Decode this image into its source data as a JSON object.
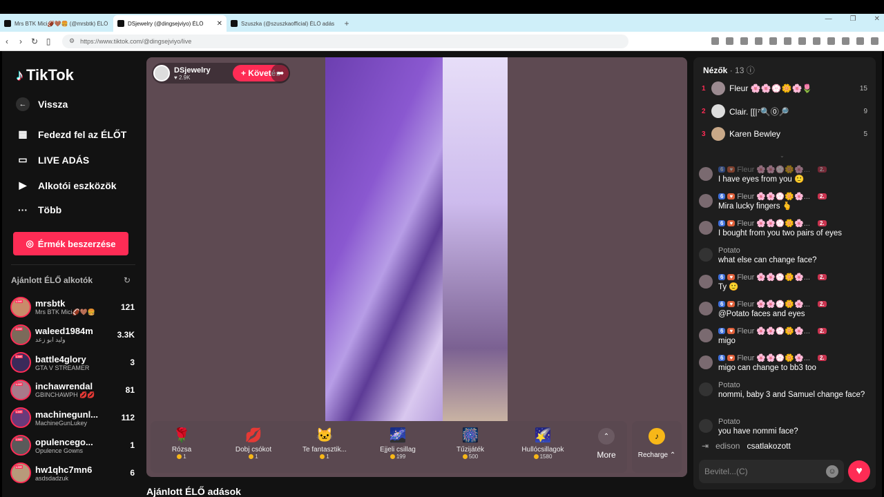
{
  "browser": {
    "tabs": [
      {
        "title": "Mrs BTK Mici🏈🤎🍔 (@mrsbtk) ÉLŐ",
        "active": false
      },
      {
        "title": "DSjewelry (@dingsejviyo) ÉLŐ",
        "active": true
      },
      {
        "title": "Szuszka (@szuszkaofficial) ÉLŐ adás",
        "active": false
      }
    ],
    "new_tab": "+",
    "url": "https://www.tiktok.com/@dingsejviyo/live"
  },
  "sidebar": {
    "logo": "TikTok",
    "back": "Vissza",
    "links": [
      {
        "label": "Fedezd fel az ÉLŐT",
        "icon": "calendar-icon"
      },
      {
        "label": "LIVE ADÁS",
        "icon": "camera-icon"
      },
      {
        "label": "Alkotói eszközök",
        "icon": "play-square-icon"
      },
      {
        "label": "Több",
        "icon": "more-icon"
      }
    ],
    "coins_button": "Érmék beszerzése",
    "recommended_title": "Ajánlott ÉLŐ alkotók",
    "live_badge": "LIVE",
    "creators": [
      {
        "name": "mrsbtk",
        "sub": "Mrs BTK Mici🏈🤎🍔",
        "count": "121"
      },
      {
        "name": "waleed1984m",
        "sub": "وليد ابو زعد",
        "count": "3.3K"
      },
      {
        "name": "battle4glory",
        "sub": "GTA V STREAMER",
        "count": "3"
      },
      {
        "name": "inchawrendal",
        "sub": "GBINCHAWPH 💋💋",
        "count": "81"
      },
      {
        "name": "machinegunl...",
        "sub": "MachineGunLukey",
        "count": "112"
      },
      {
        "name": "opulencego...",
        "sub": "Opulence Gowns",
        "count": "1"
      },
      {
        "name": "hw1qhc7mn6",
        "sub": "asdsdadzuk",
        "count": "6"
      }
    ]
  },
  "stream": {
    "host_name": "DSjewelry",
    "host_likes": "♥ 2.9K",
    "follow": "+ Követés",
    "gifts": [
      {
        "name": "Rózsa",
        "price": "1",
        "icon": "🌹"
      },
      {
        "name": "Dobj csókot",
        "price": "1",
        "icon": "💋"
      },
      {
        "name": "Te fantasztik...",
        "price": "1",
        "icon": "🐱"
      },
      {
        "name": "Éjjeli csillag",
        "price": "199",
        "icon": "🌌"
      },
      {
        "name": "Tűzijáték",
        "price": "500",
        "icon": "🎆"
      },
      {
        "name": "Hullócsillagok",
        "price": "1580",
        "icon": "🌠"
      }
    ],
    "more": "More",
    "recharge": "Recharge ⌃",
    "recommended_live": "Ajánlott ÉLŐ adások"
  },
  "chat": {
    "viewers_label": "Nézők",
    "viewers_count": "· 13",
    "top_viewers": [
      {
        "rank": "1",
        "name": "Fleur 🌸🌸💮🌼🌸🌷",
        "score": "15"
      },
      {
        "rank": "2",
        "name": "Clair. [[|⁷🔍⓪🔎",
        "score": "9"
      },
      {
        "rank": "3",
        "name": "Karen Bewley",
        "score": "5"
      }
    ],
    "badge_level": "6",
    "badge_rank": "2.",
    "fleur_name": "Fleur 🌸🌸💮🌼🌸...",
    "messages": [
      {
        "user": "Fleur 🌸🌸💮🌼🌸...",
        "text": "I have eyes from you 🙂",
        "fleur": true
      },
      {
        "user": "Fleur 🌸🌸💮🌼🌸...",
        "text": "Mira lucky fingers 🫰",
        "fleur": true
      },
      {
        "user": "Fleur 🌸🌸💮🌼🌸...",
        "text": "I bought from you two pairs of eyes",
        "fleur": true
      },
      {
        "user": "Potato",
        "text": "what else can change face?",
        "fleur": false
      },
      {
        "user": "Fleur 🌸🌸💮🌼🌸...",
        "text": "Ty 🙂",
        "fleur": true
      },
      {
        "user": "Fleur 🌸🌸💮🌼🌸...",
        "text": "@Potato faces and eyes",
        "fleur": true
      },
      {
        "user": "Fleur 🌸🌸💮🌼🌸...",
        "text": "migo",
        "fleur": true
      },
      {
        "user": "Fleur 🌸🌸💮🌼🌸...",
        "text": "migo can change to bb3 too",
        "fleur": true
      },
      {
        "user": "Potato",
        "text": "nommi, baby 3 and Samuel change face?",
        "fleur": false
      },
      {
        "user": "Potato",
        "text": "you have nommi face?",
        "fleur": false
      }
    ],
    "joined_user": "edison",
    "joined_text": "csatlakozott",
    "input_placeholder": "Bevitel...(C)"
  }
}
